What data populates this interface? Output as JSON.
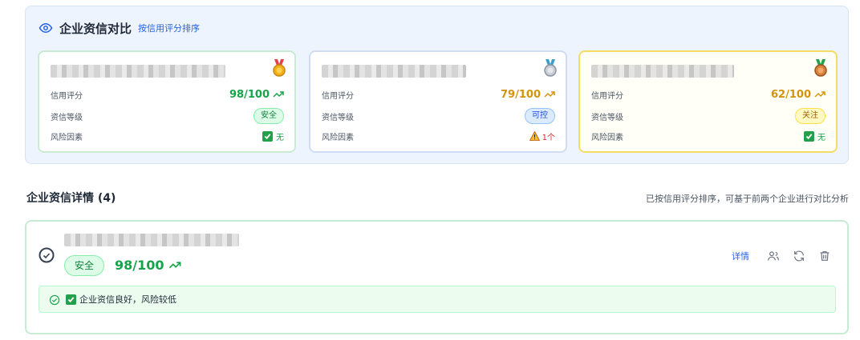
{
  "compare": {
    "title": "企业资信对比",
    "sort_label": "按信用评分排序",
    "labels": {
      "credit_score": "信用评分",
      "credit_level": "资信等级",
      "risk_factors": "风险因素"
    },
    "cards": [
      {
        "score": "98/100",
        "level": "安全",
        "risk": "无",
        "medal": "gold",
        "trend": "up"
      },
      {
        "score": "79/100",
        "level": "可控",
        "risk": "1个",
        "medal": "silver",
        "trend": "up"
      },
      {
        "score": "62/100",
        "level": "关注",
        "risk": "无",
        "medal": "bronze",
        "trend": "up"
      }
    ]
  },
  "details": {
    "title": "企业资信详情 (4)",
    "hint": "已按信用评分排序，可基于前两个企业进行对比分析",
    "item": {
      "level": "安全",
      "score": "98/100",
      "detail_link": "详情",
      "note": "企业资信良好，风险较低"
    }
  },
  "colors": {
    "green": "#16a34a",
    "orange": "#d4930b",
    "blue": "#2563eb",
    "red": "#dc2626"
  }
}
